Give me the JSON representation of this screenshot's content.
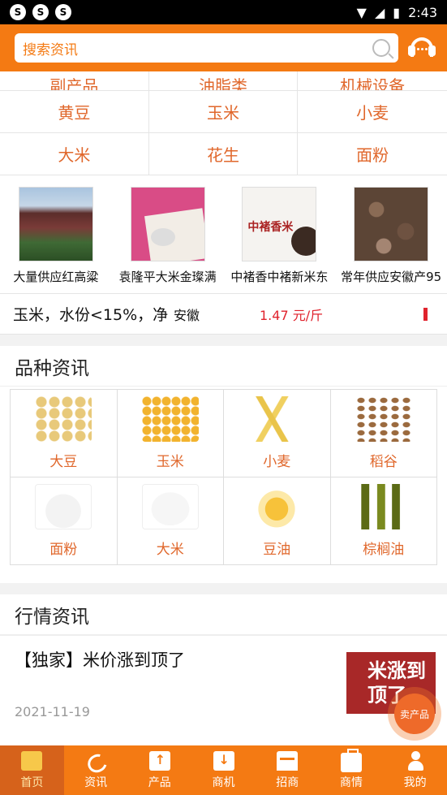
{
  "status": {
    "time": "2:43"
  },
  "search": {
    "placeholder": "搜索资讯"
  },
  "categories_partial": [
    "副产品",
    "油脂类",
    "机械设备"
  ],
  "categories": [
    "黄豆",
    "玉米",
    "小麦",
    "大米",
    "花生",
    "面粉"
  ],
  "products": [
    {
      "name": "大量供应红高粱",
      "image": "sorghum"
    },
    {
      "name": "袁隆平大米金璨满",
      "image": "rice"
    },
    {
      "name": "中褚香中褚新米东",
      "image": "rice2",
      "image_text": "中褚香米"
    },
    {
      "name": "常年供应安徽产95",
      "image": "dried"
    }
  ],
  "quote": {
    "name": "玉米，水份<15%，净",
    "location": "安徽",
    "price": "1.47 元/斤",
    "accent": "#e0232d"
  },
  "variety": {
    "title": "品种资讯",
    "items": [
      {
        "label": "大豆",
        "image": "soy"
      },
      {
        "label": "玉米",
        "image": "corn"
      },
      {
        "label": "小麦",
        "image": "wheat"
      },
      {
        "label": "稻谷",
        "image": "rice-grain"
      },
      {
        "label": "面粉",
        "image": "flour"
      },
      {
        "label": "大米",
        "image": "white-rice"
      },
      {
        "label": "豆油",
        "image": "soyoil"
      },
      {
        "label": "棕榈油",
        "image": "palmoil"
      }
    ]
  },
  "news": {
    "title": "行情资讯",
    "items": [
      {
        "title": "【独家】米价涨到顶了",
        "date": "2021-11-19",
        "thumb_text": "米涨到顶了"
      }
    ]
  },
  "fab": {
    "label": "卖产品"
  },
  "tabs": [
    {
      "label": "首页",
      "icon": "monitor-icon",
      "active": true
    },
    {
      "label": "资讯",
      "icon": "satellite-dish-icon"
    },
    {
      "label": "产品",
      "icon": "box-upload-icon"
    },
    {
      "label": "商机",
      "icon": "box-download-icon"
    },
    {
      "label": "招商",
      "icon": "store-icon"
    },
    {
      "label": "商情",
      "icon": "briefcase-icon"
    },
    {
      "label": "我的",
      "icon": "user-icon"
    }
  ],
  "colors": {
    "brand": "#f47a13",
    "active_tab": "#d6621b",
    "category_text": "#e0672b"
  }
}
